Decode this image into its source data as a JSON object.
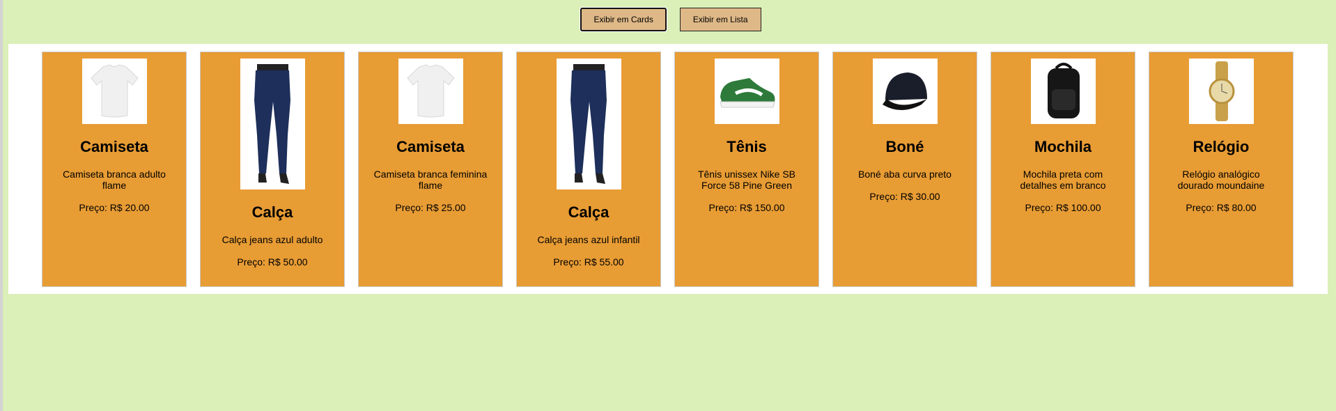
{
  "toolbar": {
    "cards_label": "Exibir em Cards",
    "list_label": "Exibir em Lista"
  },
  "products": [
    {
      "name": "Camiseta",
      "description": "Camiseta branca adulto flame",
      "price": "Preço: R$ 20.00",
      "image": "white-tshirt"
    },
    {
      "name": "Calça",
      "description": "Calça jeans azul adulto",
      "price": "Preço: R$ 50.00",
      "image": "blue-jeans"
    },
    {
      "name": "Camiseta",
      "description": "Camiseta branca feminina flame",
      "price": "Preço: R$ 25.00",
      "image": "white-tshirt"
    },
    {
      "name": "Calça",
      "description": "Calça jeans azul infantil",
      "price": "Preço: R$ 55.00",
      "image": "blue-jeans"
    },
    {
      "name": "Tênis",
      "description": "Tênis unissex Nike SB Force 58 Pine Green",
      "price": "Preço: R$ 150.00",
      "image": "green-sneaker"
    },
    {
      "name": "Boné",
      "description": "Boné aba curva preto",
      "price": "Preço: R$ 30.00",
      "image": "black-cap"
    },
    {
      "name": "Mochila",
      "description": "Mochila preta com detalhes em branco",
      "price": "Preço: R$ 100.00",
      "image": "black-backpack"
    },
    {
      "name": "Relógio",
      "description": "Relógio analógico dourado moundaine",
      "price": "Preço: R$ 80.00",
      "image": "gold-watch"
    }
  ]
}
